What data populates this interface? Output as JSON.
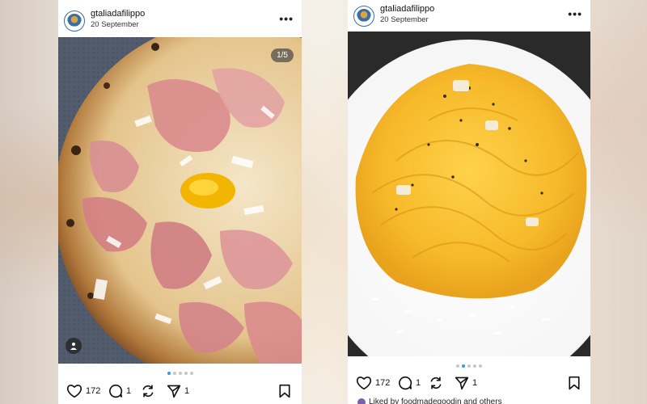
{
  "posts": [
    {
      "username": "gtaliadafilippo",
      "date": "20 September",
      "counter": "1/5",
      "likes": "172",
      "comments": "1",
      "shares": "1"
    },
    {
      "username": "gtaliadafilippo",
      "date": "20 September",
      "likes": "172",
      "comments": "1",
      "shares": "1",
      "liked_by": "Liked by foodmadegoodin and others"
    }
  ],
  "carousel": {
    "left": {
      "total": 5,
      "active": 1
    },
    "right": {
      "total": 5,
      "active": 2
    }
  },
  "icons": {
    "more": "more-options-icon",
    "like": "heart-icon",
    "comment": "comment-bubble-icon",
    "repost": "repost-icon",
    "share": "paper-plane-icon",
    "save": "bookmark-icon",
    "tag": "person-tag-icon"
  },
  "colors": {
    "active_dot": "#3897f0",
    "inactive_dot": "#c7c7c7"
  }
}
